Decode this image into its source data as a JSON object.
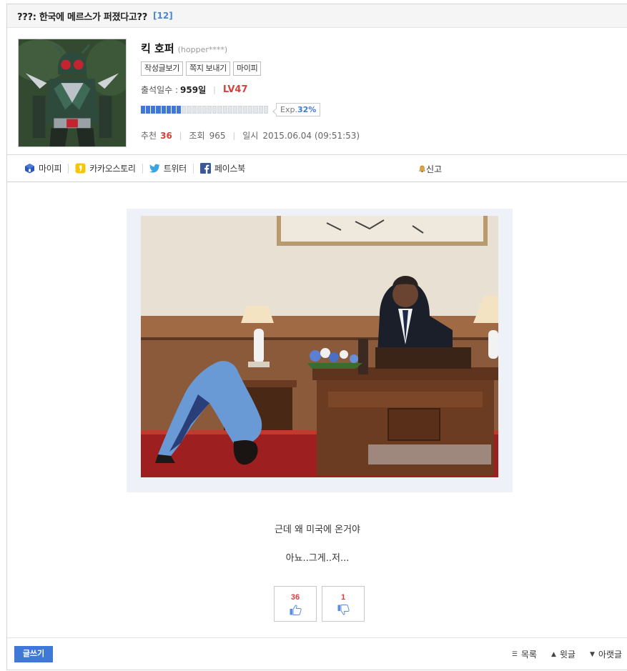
{
  "post": {
    "title": "???: 한국에 메르스가 퍼졌다고??",
    "comment_count": "[12]"
  },
  "author": {
    "nickname": "킥 호퍼",
    "user_id": "(hopper****)",
    "buttons": [
      "작성글보기",
      "쪽지 보내기",
      "마이피"
    ],
    "attendance_label": "출석일수 :",
    "attendance_days": "959일",
    "level": "LV47",
    "exp_label": "Exp.",
    "exp_percent": "32%",
    "exp_fraction": 0.32
  },
  "meta": {
    "recommend_label": "추천",
    "recommend_count": "36",
    "views_label": "조회",
    "views_count": "965",
    "date_label": "일시",
    "date_value": "2015.06.04 (09:51:53)"
  },
  "share": {
    "items": [
      {
        "label": "마이피",
        "icon": "mypi-icon",
        "color": "#2a57b8"
      },
      {
        "label": "카카오스토리",
        "icon": "kakaostory-icon",
        "color": "#f7c600"
      },
      {
        "label": "트위터",
        "icon": "twitter-icon",
        "color": "#3aa3e3"
      },
      {
        "label": "페이스북",
        "icon": "facebook-icon",
        "color": "#3b5998"
      }
    ],
    "report_label": "신고"
  },
  "body": {
    "line1": "근데 왜 미국에 온거야",
    "line2": "아뇨..그게..저..."
  },
  "votes": {
    "up_count": "36",
    "down_count": "1"
  },
  "footer": {
    "write_label": "글쓰기",
    "list_label": "목록",
    "prev_label": "윗글",
    "next_label": "아랫글"
  },
  "colors": {
    "accent": "#3f78d6",
    "highlight_red": "#d9403c"
  }
}
